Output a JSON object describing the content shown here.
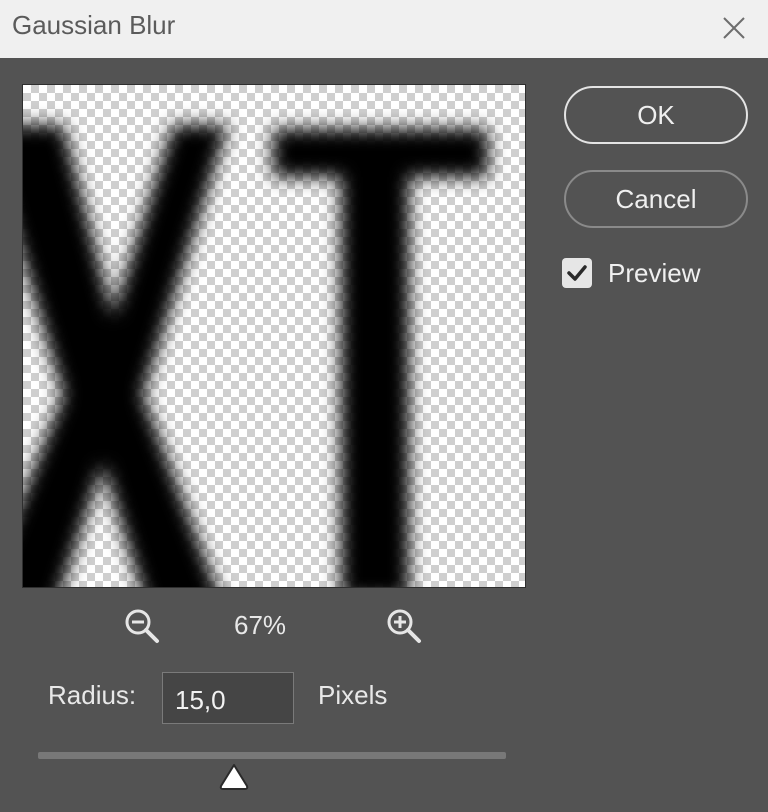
{
  "window": {
    "title": "Gaussian Blur",
    "close_icon": "close-icon"
  },
  "buttons": {
    "ok_label": "OK",
    "cancel_label": "Cancel"
  },
  "preview": {
    "label": "Preview",
    "checked": true,
    "zoom_level": "67%",
    "zoom_out_icon": "zoom-out-icon",
    "zoom_in_icon": "zoom-in-icon",
    "visible_letters": "XT"
  },
  "radius": {
    "label": "Radius:",
    "value": "15,0",
    "unit": "Pixels"
  },
  "colors": {
    "dialog_bg": "#535353",
    "titlebar_bg": "#f0f0f0",
    "text": "#e8e8e8"
  }
}
